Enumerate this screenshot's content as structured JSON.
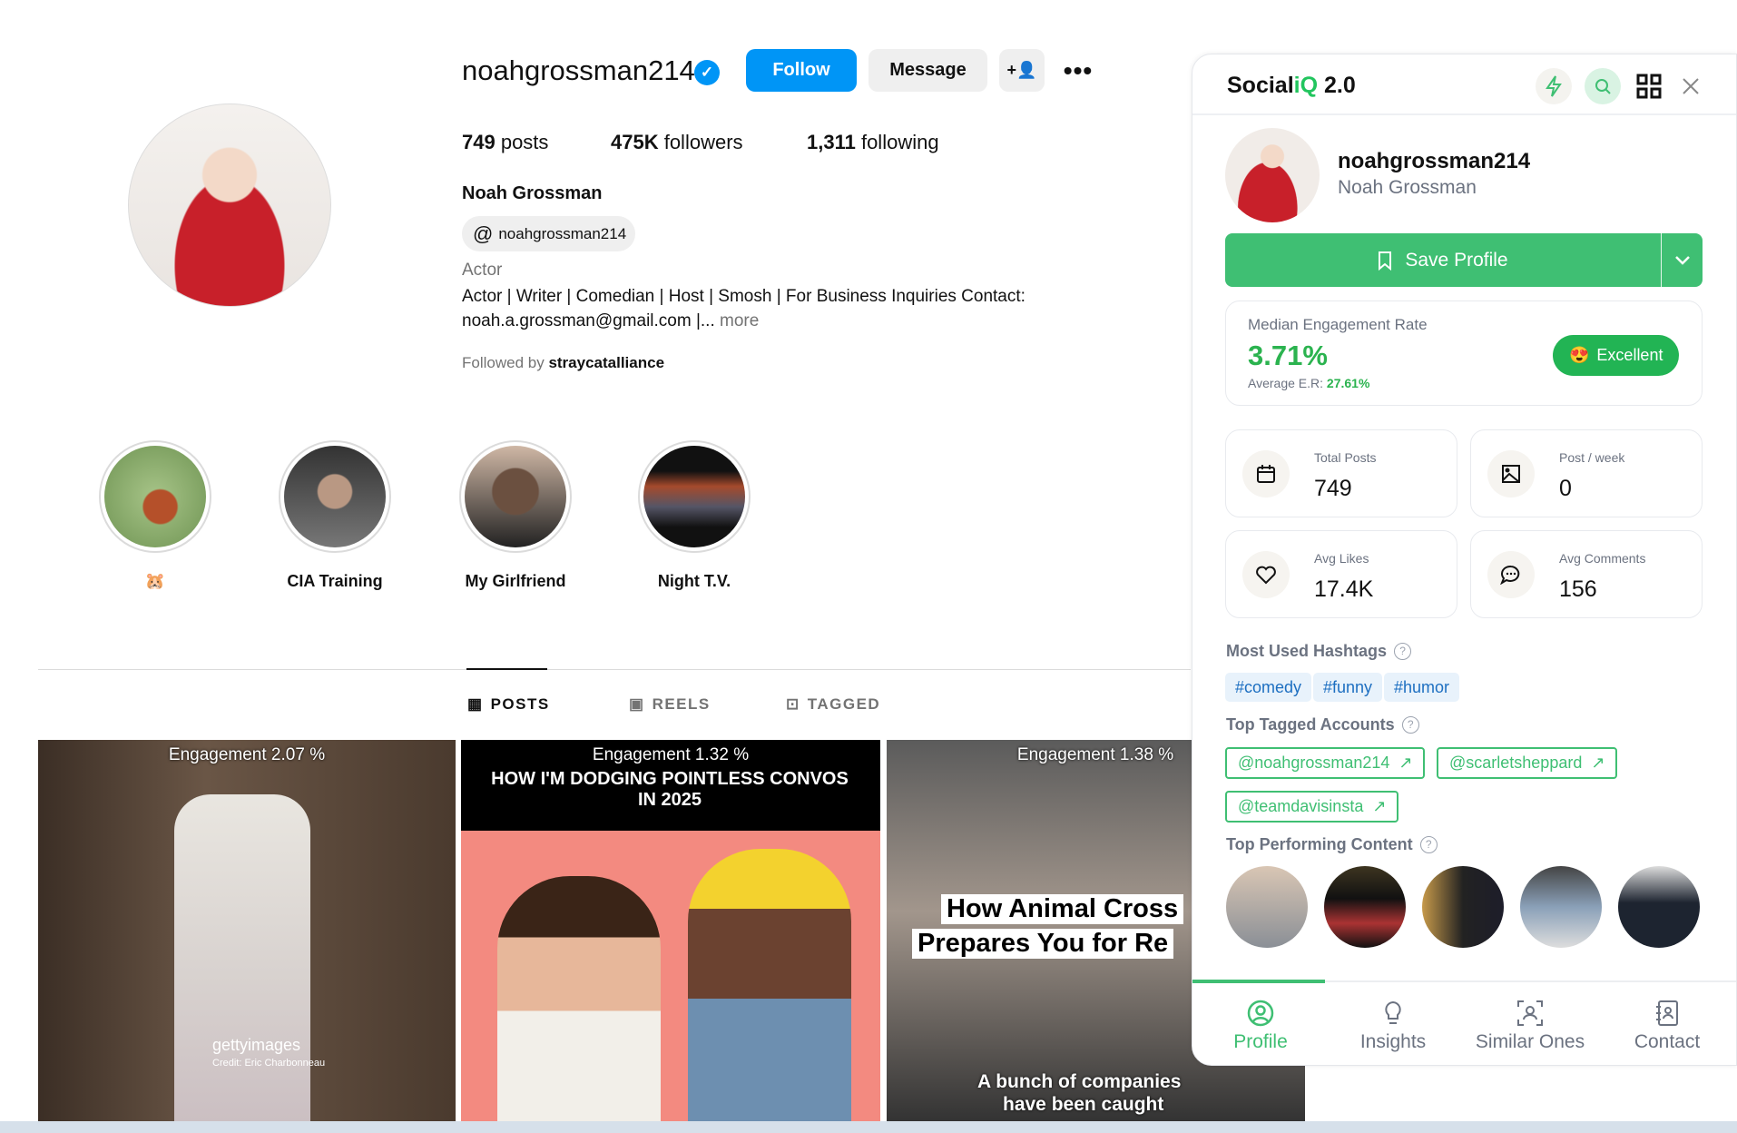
{
  "profile": {
    "username": "noahgrossman214",
    "follow_label": "Follow",
    "message_label": "Message",
    "stats": {
      "posts": "749",
      "posts_label": " posts",
      "followers": "475K",
      "followers_label": " followers",
      "following": "1,311",
      "following_label": " following"
    },
    "full_name": "Noah Grossman",
    "threads_handle": "noahgrossman214",
    "category": "Actor",
    "bio_line1": "Actor | Writer | Comedian | Host | Smosh | For Business Inquiries Contact:",
    "bio_line2": "noah.a.grossman@gmail.com |...",
    "more_label": " more",
    "followed_by_prefix": "Followed by ",
    "followed_by": "straycatalliance"
  },
  "highlights": [
    {
      "label": "🐹"
    },
    {
      "label": "CIA Training"
    },
    {
      "label": "My Girlfriend"
    },
    {
      "label": "Night T.V."
    }
  ],
  "tabs": [
    {
      "label": "POSTS",
      "active": true
    },
    {
      "label": "REELS"
    },
    {
      "label": "TAGGED"
    }
  ],
  "posts": [
    {
      "engagement": "Engagement 2.07 %",
      "watermark": "gettyimages",
      "credit": "Credit: Eric Charbonneau"
    },
    {
      "engagement": "Engagement 1.32 %",
      "caption": "HOW I'M DODGING POINTLESS CONVOS IN 2025"
    },
    {
      "engagement": "Engagement 1.38 %",
      "caption1": "How Animal Cross",
      "caption2": "Prepares You for Re",
      "bottom1": "A bunch of companies",
      "bottom2": "have been caught"
    }
  ],
  "panel": {
    "title_a": "Social",
    "title_b": "iQ",
    "title_c": " 2.0",
    "username": "noahgrossman214",
    "full_name": "Noah Grossman",
    "save_label": "Save Profile",
    "er_label": "Median Engagement Rate",
    "er_value": "3.71%",
    "avg_label": "Average E.R: ",
    "avg_value": "27.61%",
    "rating": "Excellent",
    "cards": [
      {
        "label": "Total Posts",
        "value": "749",
        "icon": "calendar-icon"
      },
      {
        "label": "Post / week",
        "value": "0",
        "icon": "image-icon"
      },
      {
        "label": "Avg Likes",
        "value": "17.4K",
        "icon": "heart-icon"
      },
      {
        "label": "Avg Comments",
        "value": "156",
        "icon": "comment-icon"
      }
    ],
    "hashtags_title": "Most Used Hashtags",
    "hashtags": [
      "#comedy",
      "#funny",
      "#humor"
    ],
    "tagged_title": "Top Tagged Accounts",
    "tagged": [
      "@noahgrossman214",
      "@scarletsheppard",
      "@teamdavisinsta"
    ],
    "top_title": "Top Performing Content",
    "nav": [
      {
        "label": "Profile",
        "active": true
      },
      {
        "label": "Insights"
      },
      {
        "label": "Similar Ones"
      },
      {
        "label": "Contact"
      }
    ],
    "colors": {
      "accent": "#3fbf73",
      "blue": "#0095f6"
    }
  }
}
